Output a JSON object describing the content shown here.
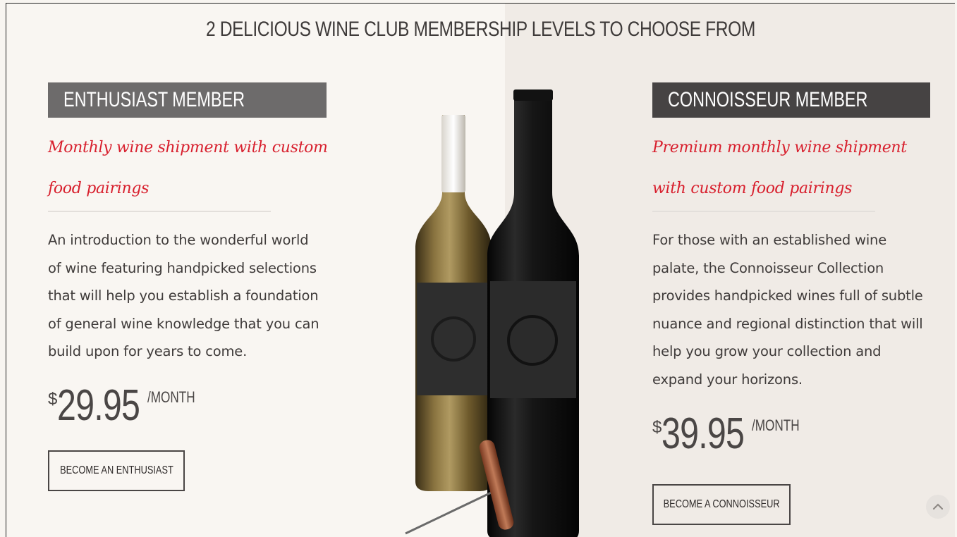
{
  "headline": "2 DELICIOUS WINE CLUB MEMBERSHIP LEVELS TO CHOOSE FROM",
  "enthusiast": {
    "title": "ENTHUSIAST MEMBER",
    "tagline_line1": "Monthly wine shipment with custom",
    "tagline_line2": "food pairings",
    "description": [
      "An introduction to the wonderful world",
      "of wine featuring handpicked selections",
      "that will help you establish a foundation",
      "of general wine knowledge that you can",
      "build upon for years to come."
    ],
    "currency": "$",
    "price": "29.95",
    "period": "/MONTH",
    "button_label": "BECOME AN ENTHUSIAST"
  },
  "connoisseur": {
    "title": "CONNOISSEUR MEMBER",
    "tagline_line1": "Premium monthly wine shipment",
    "tagline_line2": "with custom food pairings",
    "description": [
      "For those with an established wine",
      "palate, the Connoisseur Collection",
      "provides handpicked wines full of subtle",
      "nuance and regional distinction that will",
      "help you grow your collection and",
      "expand your horizons."
    ],
    "currency": "$",
    "price": "39.95",
    "period": "/MONTH",
    "button_label": "BECOME A CONNOISSEUR"
  },
  "colors": {
    "accent_red": "#d8202e",
    "title_bar_gray": "#6d6b6b",
    "title_bar_dark": "#464343"
  },
  "icons": {
    "scroll_top": "chevron-up-icon"
  }
}
